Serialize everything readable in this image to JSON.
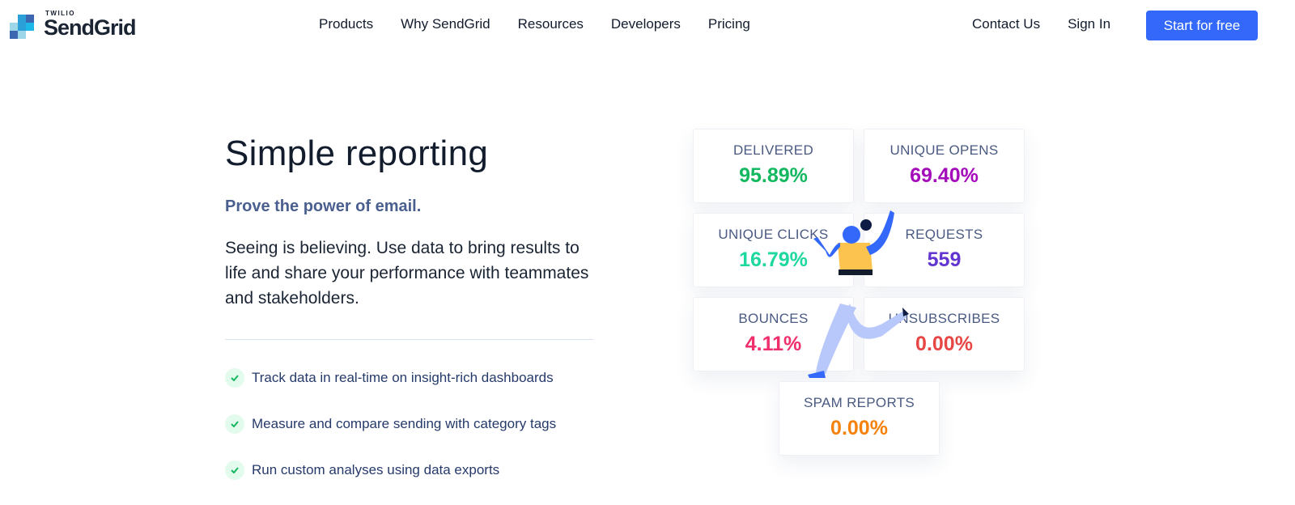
{
  "brand": {
    "top": "TWILIO",
    "name": "SendGrid"
  },
  "nav": [
    "Products",
    "Why SendGrid",
    "Resources",
    "Developers",
    "Pricing"
  ],
  "header_right": {
    "contact": "Contact Us",
    "signin": "Sign In",
    "cta": "Start for free"
  },
  "hero": {
    "title": "Simple reporting",
    "subtitle": "Prove the power of email.",
    "description": "Seeing is believing. Use data to bring results to life and share your performance with teammates and stakeholders.",
    "features": [
      "Track data in real-time on insight-rich dashboards",
      "Measure and compare sending with category tags",
      "Run custom analyses using data exports"
    ]
  },
  "stats": [
    {
      "label": "DELIVERED",
      "value": "95.89%",
      "color": "#14b860"
    },
    {
      "label": "UNIQUE OPENS",
      "value": "69.40%",
      "color": "#a40bba"
    },
    {
      "label": "UNIQUE CLICKS",
      "value": "16.79%",
      "color": "#1ed8a0"
    },
    {
      "label": "REQUESTS",
      "value": "559",
      "color": "#6235d0"
    },
    {
      "label": "BOUNCES",
      "value": "4.11%",
      "color": "#ee2f6b"
    },
    {
      "label": "UNSUBSCRIBES",
      "value": "0.00%",
      "color": "#e84545"
    },
    {
      "label": "SPAM REPORTS",
      "value": "0.00%",
      "color": "#f5820d"
    }
  ],
  "colors": {
    "accent": "#3368fa",
    "check": "#14b860"
  }
}
